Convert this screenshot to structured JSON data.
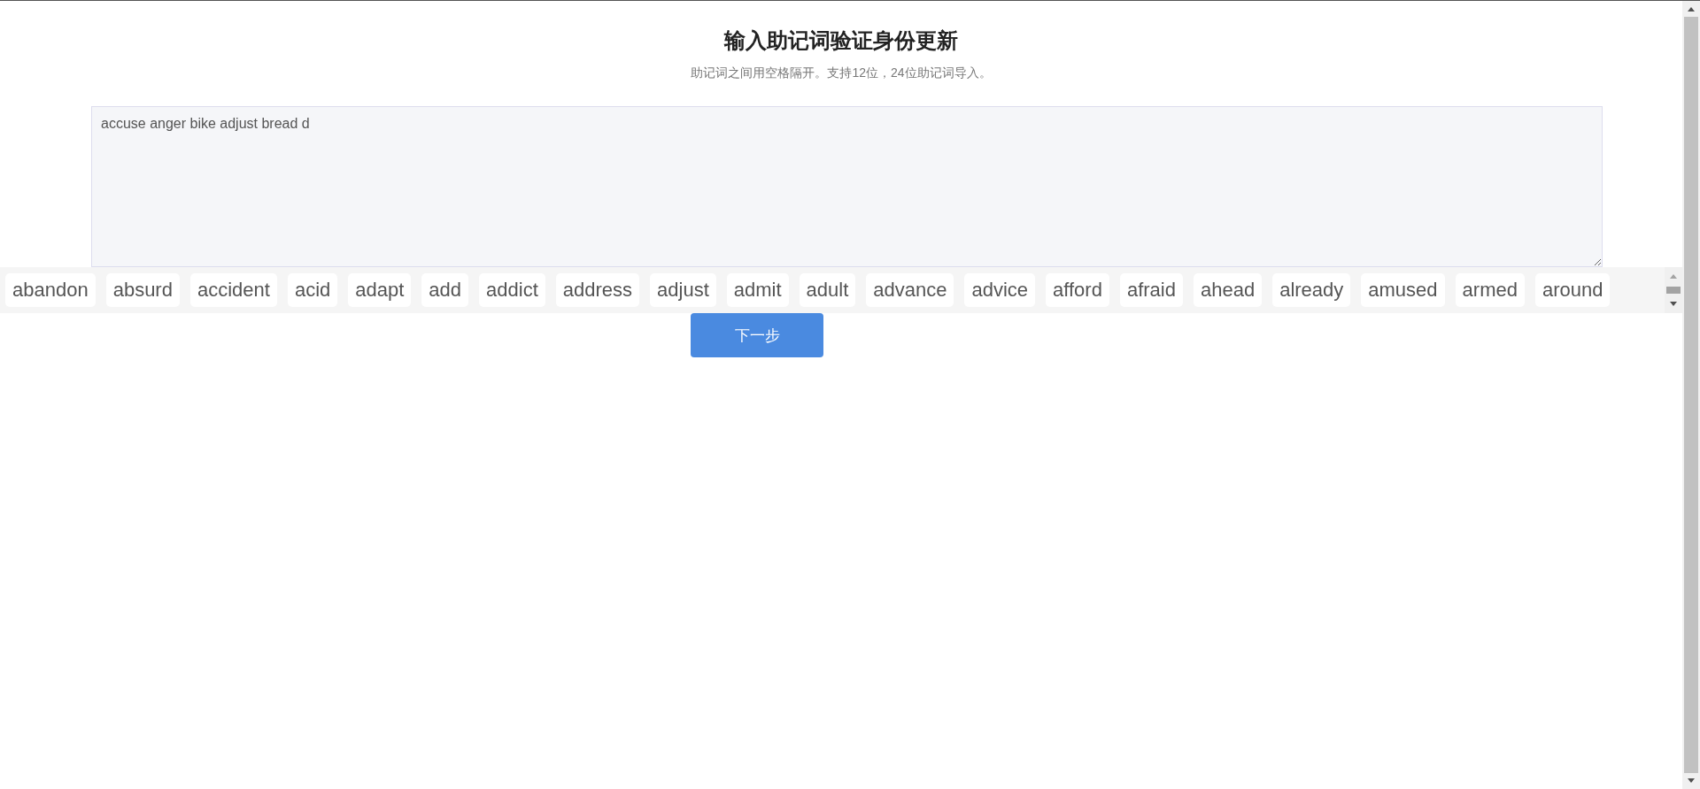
{
  "title": "输入助记词验证身份更新",
  "subtitle": "助记词之间用空格隔开。支持12位，24位助记词导入。",
  "mnemonic_input": {
    "value": "accuse anger bike adjust bread d"
  },
  "suggestions": [
    "abandon",
    "absurd",
    "accident",
    "acid",
    "adapt",
    "add",
    "addict",
    "address",
    "adjust",
    "admit",
    "adult",
    "advance",
    "advice",
    "afford",
    "afraid",
    "ahead",
    "already",
    "amused",
    "armed",
    "around"
  ],
  "next_button": "下一步"
}
